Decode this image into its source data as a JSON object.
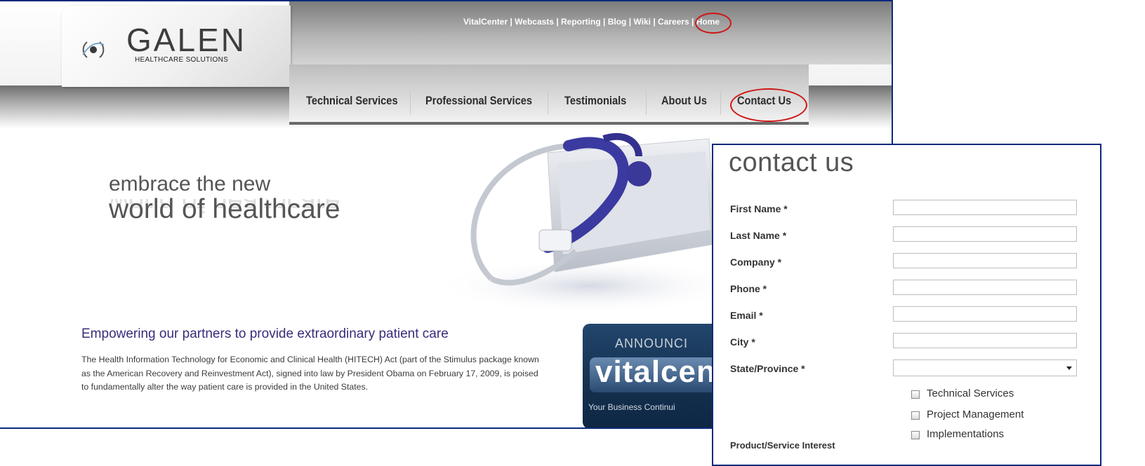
{
  "header": {
    "logo": {
      "name": "GALEN",
      "subtitle": "HEALTHCARE SOLUTIONS"
    },
    "top_links": [
      "VitalCenter",
      "Webcasts",
      "Reporting",
      "Blog",
      "Wiki",
      "Careers",
      "Home"
    ],
    "top_link_separator": " | "
  },
  "nav": {
    "items": [
      "Technical Services",
      "Professional Services",
      "Testimonials",
      "About Us",
      "Contact Us"
    ]
  },
  "hero": {
    "line1": "embrace the new",
    "line2": "world of healthcare"
  },
  "content": {
    "headline": "Empowering our partners to provide extraordinary patient care",
    "body": "The Health Information Technology for Economic and Clinical Health (HITECH) Act (part of the Stimulus package known as the American Recovery and Reinvestment Act), signed into law by President Obama on February 17, 2009, is poised to fundamentally alter the way patient care is provided in the United States."
  },
  "banner": {
    "announce": "ANNOUNCI",
    "word": "vitalcen",
    "tagline": "Your Business Continui"
  },
  "contact_form": {
    "title": "contact us",
    "fields": [
      {
        "label": "First Name *",
        "value": ""
      },
      {
        "label": "Last Name *",
        "value": ""
      },
      {
        "label": "Company *",
        "value": ""
      },
      {
        "label": "Phone *",
        "value": ""
      },
      {
        "label": "Email *",
        "value": ""
      },
      {
        "label": "City *",
        "value": ""
      }
    ],
    "state": {
      "label": "State/Province *",
      "value": ""
    },
    "interest_label": "Product/Service Interest",
    "interests": [
      "Technical Services",
      "Project Management",
      "Implementations"
    ]
  },
  "annotations": {
    "highlight_color": "#d01515",
    "frame_color": "#0b2a7a"
  }
}
